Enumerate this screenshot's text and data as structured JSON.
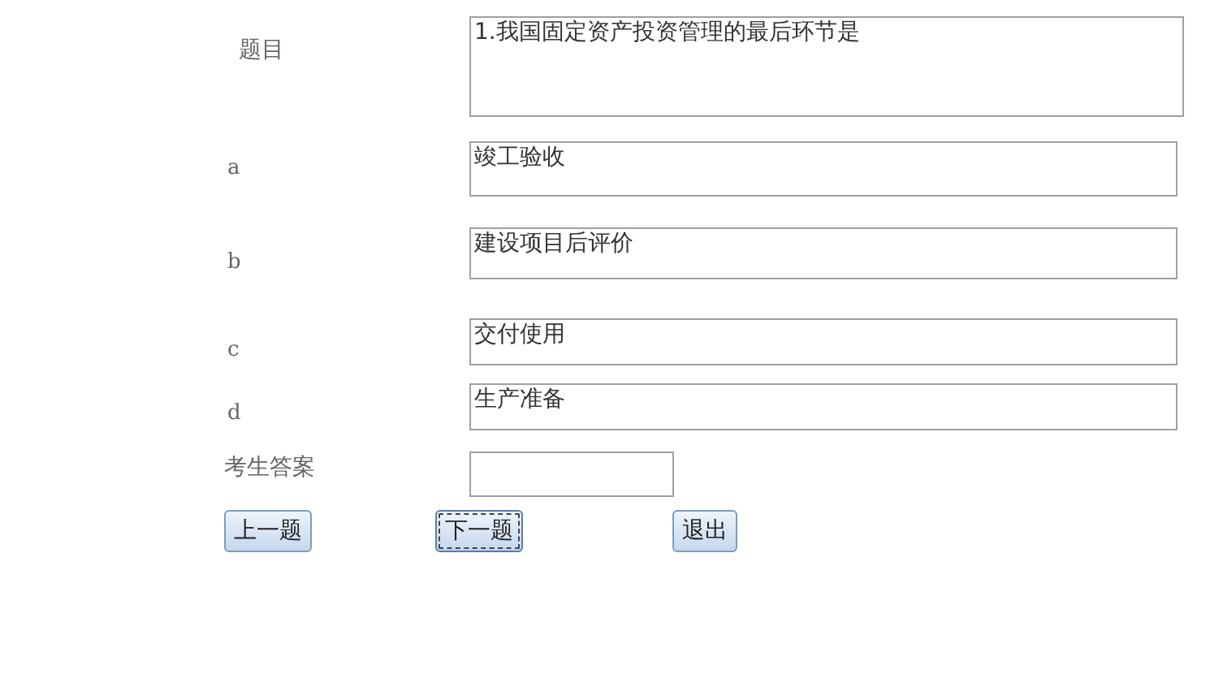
{
  "question": {
    "label": "题目",
    "text": "1.我国固定资产投资管理的最后环节是"
  },
  "options": [
    {
      "label": "a",
      "text": "竣工验收"
    },
    {
      "label": "b",
      "text": "建设项目后评价"
    },
    {
      "label": "c",
      "text": "交付使用"
    },
    {
      "label": "d",
      "text": "生产准备"
    }
  ],
  "answer": {
    "label": "考生答案"
  },
  "buttons": [
    {
      "label": "上一题",
      "focused": false
    },
    {
      "label": "下一题",
      "focused": true
    },
    {
      "label": "退出",
      "focused": false
    }
  ]
}
